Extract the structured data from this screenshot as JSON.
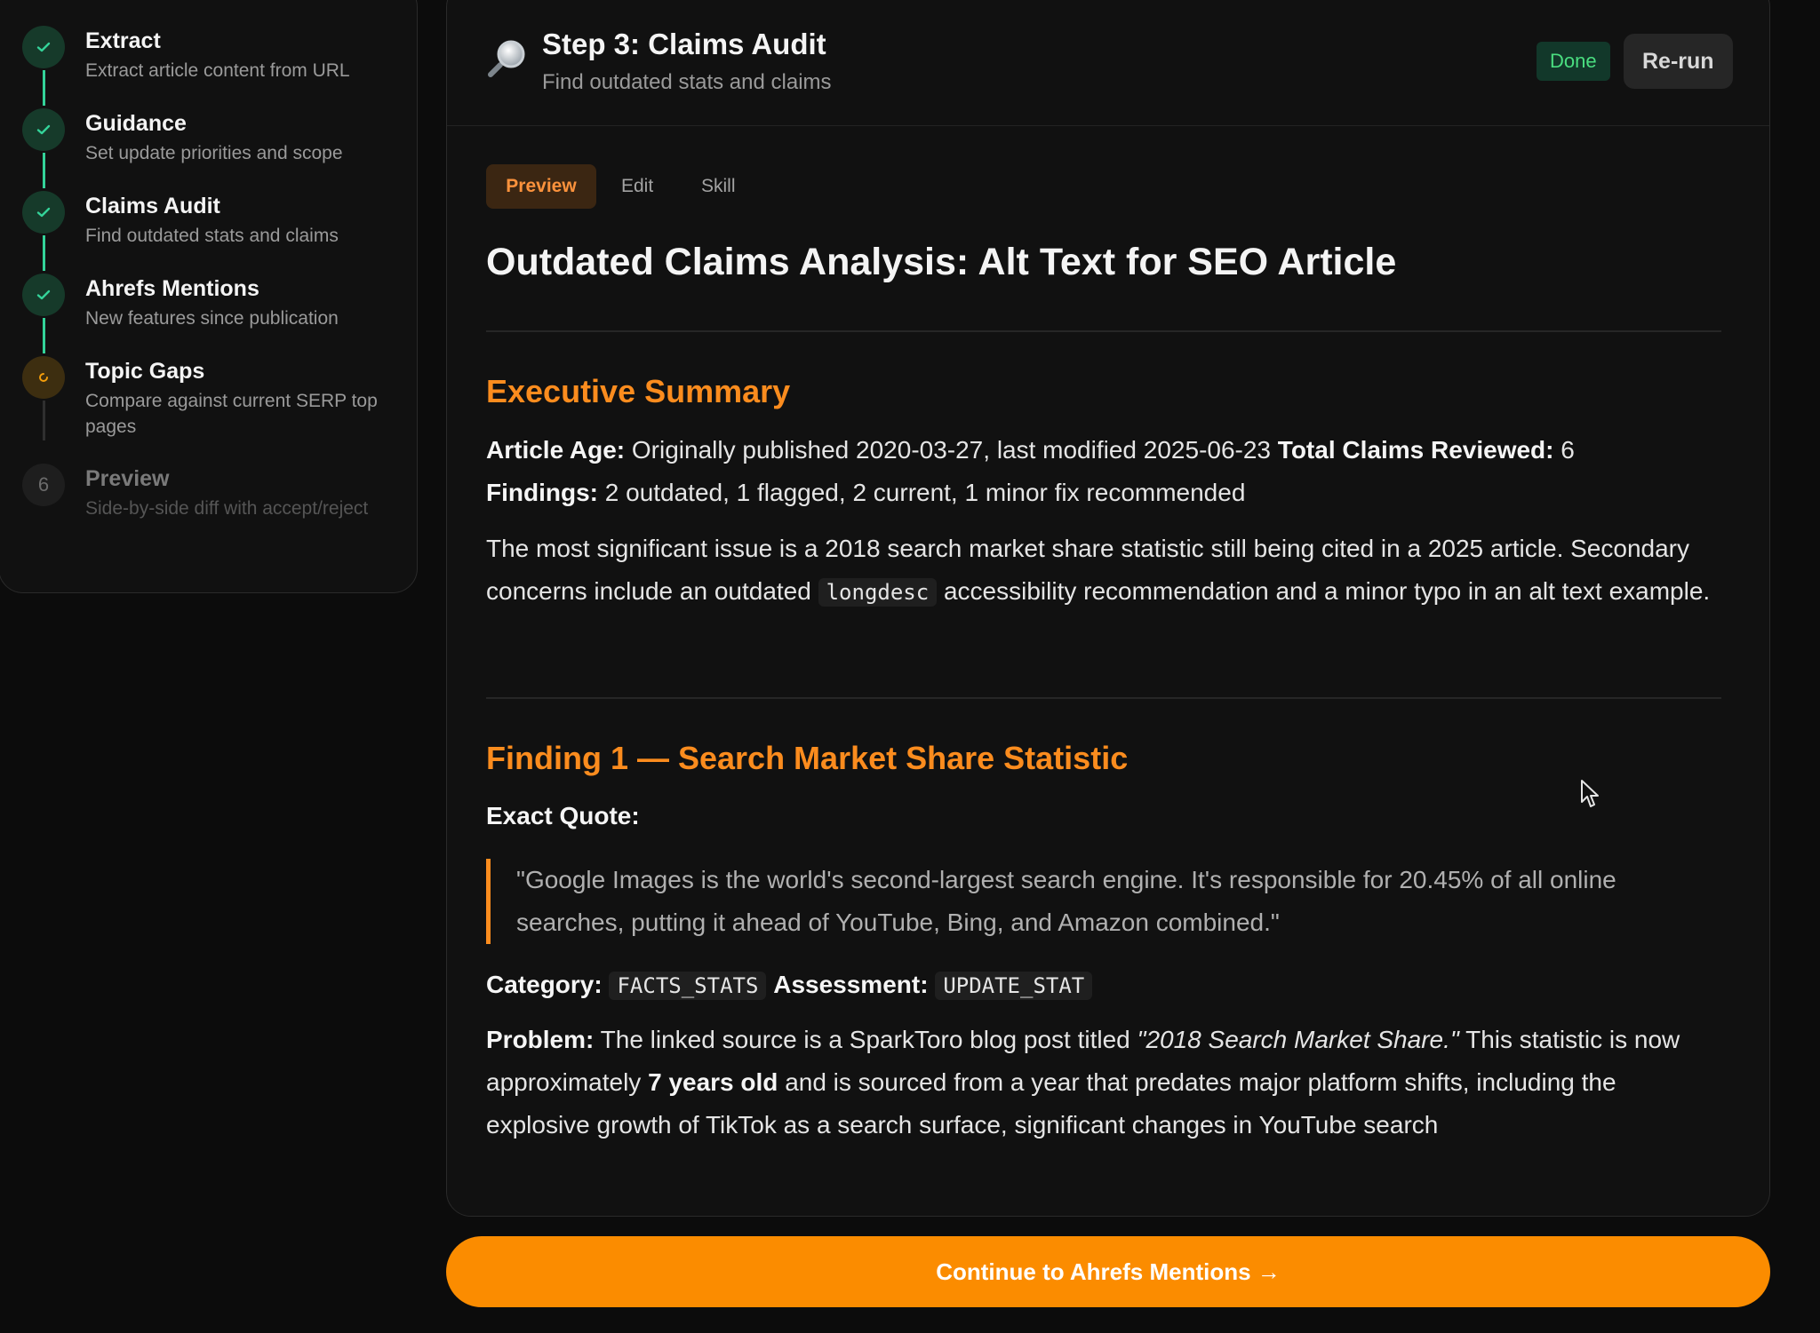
{
  "sidebar": {
    "steps": [
      {
        "title": "Extract",
        "desc": "Extract article content from URL",
        "status": "done"
      },
      {
        "title": "Guidance",
        "desc": "Set update priorities and scope",
        "status": "done"
      },
      {
        "title": "Claims Audit",
        "desc": "Find outdated stats and claims",
        "status": "done"
      },
      {
        "title": "Ahrefs Mentions",
        "desc": "New features since publication",
        "status": "done"
      },
      {
        "title": "Topic Gaps",
        "desc": "Compare against current SERP top pages",
        "status": "active"
      },
      {
        "title": "Preview",
        "desc": "Side-by-side diff with accept/reject",
        "status": "pending",
        "number": "6"
      }
    ]
  },
  "header": {
    "title": "Step 3: Claims Audit",
    "subtitle": "Find outdated stats and claims",
    "status_badge": "Done",
    "rerun_label": "Re-run"
  },
  "tabs": {
    "preview": "Preview",
    "edit": "Edit",
    "skill": "Skill"
  },
  "report": {
    "title": "Outdated Claims Analysis: Alt Text for SEO Article",
    "executive_summary": {
      "heading": "Executive Summary",
      "article_age_label": "Article Age:",
      "article_age_value": "Originally published 2020-03-27, last modified 2025-06-23",
      "total_claims_label": "Total Claims Reviewed:",
      "total_claims_value": "6",
      "findings_label": "Findings:",
      "findings_value": "2 outdated, 1 flagged, 2 current, 1 minor fix recommended",
      "body_part1": "The most significant issue is a 2018 search market share statistic still being cited in a 2025 article. Secondary concerns include an outdated",
      "body_code": "longdesc",
      "body_part2": "accessibility recommendation and a minor typo in an alt text example."
    },
    "finding1": {
      "heading": "Finding 1 — Search Market Share Statistic",
      "exact_quote_label": "Exact Quote:",
      "quote": "\"Google Images is the world's second-largest search engine. It's responsible for 20.45% of all online searches, putting it ahead of YouTube, Bing, and Amazon combined.\"",
      "category_label": "Category:",
      "category_value": "FACTS_STATS",
      "assessment_label": "Assessment:",
      "assessment_value": "UPDATE_STAT",
      "problem_label": "Problem:",
      "problem_part1": "The linked source is a SparkToro blog post titled",
      "problem_source": "\"2018 Search Market Share.\"",
      "problem_part2": "This statistic is now approximately",
      "problem_bold": "7 years old",
      "problem_part3": "and is sourced from a year that predates major platform shifts, including the explosive growth of TikTok as a search surface, significant changes in YouTube search"
    }
  },
  "cta": {
    "label": "Continue to Ahrefs Mentions →"
  },
  "colors": {
    "accent": "#fb8c00",
    "heading": "#fb8c1e",
    "done": "#34d399",
    "active": "#f59e0b"
  }
}
